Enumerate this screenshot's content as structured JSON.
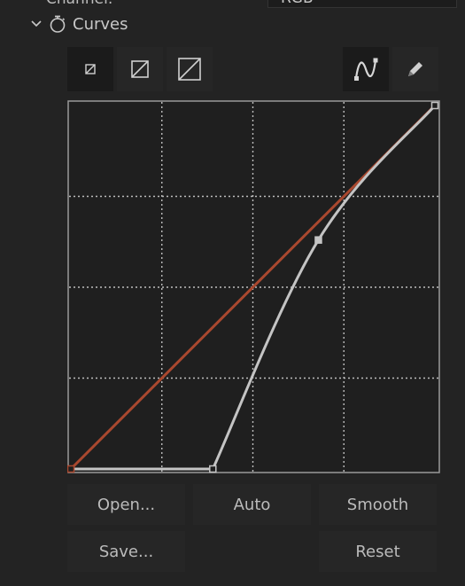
{
  "channel": {
    "label": "Channel:",
    "value": "RGB"
  },
  "section": {
    "title": "Curves"
  },
  "tools": {
    "size_small": "curves-size-small-icon",
    "size_medium": "curves-size-medium-icon",
    "size_large": "curves-size-large-icon",
    "bezier": "bezier-curve-icon",
    "pencil": "pencil-icon"
  },
  "curve": {
    "identity_color": "#a9482f",
    "curve_color": "#c4c4c4",
    "points": [
      {
        "input": 0.0,
        "output": 0.0
      },
      {
        "input": 0.39,
        "output": 0.0
      },
      {
        "input": 0.68,
        "output": 0.63
      },
      {
        "input": 1.0,
        "output": 1.0
      }
    ],
    "grid_divisions": 4
  },
  "buttons": {
    "open": "Open...",
    "auto": "Auto",
    "smooth": "Smooth",
    "save": "Save...",
    "reset": "Reset"
  }
}
